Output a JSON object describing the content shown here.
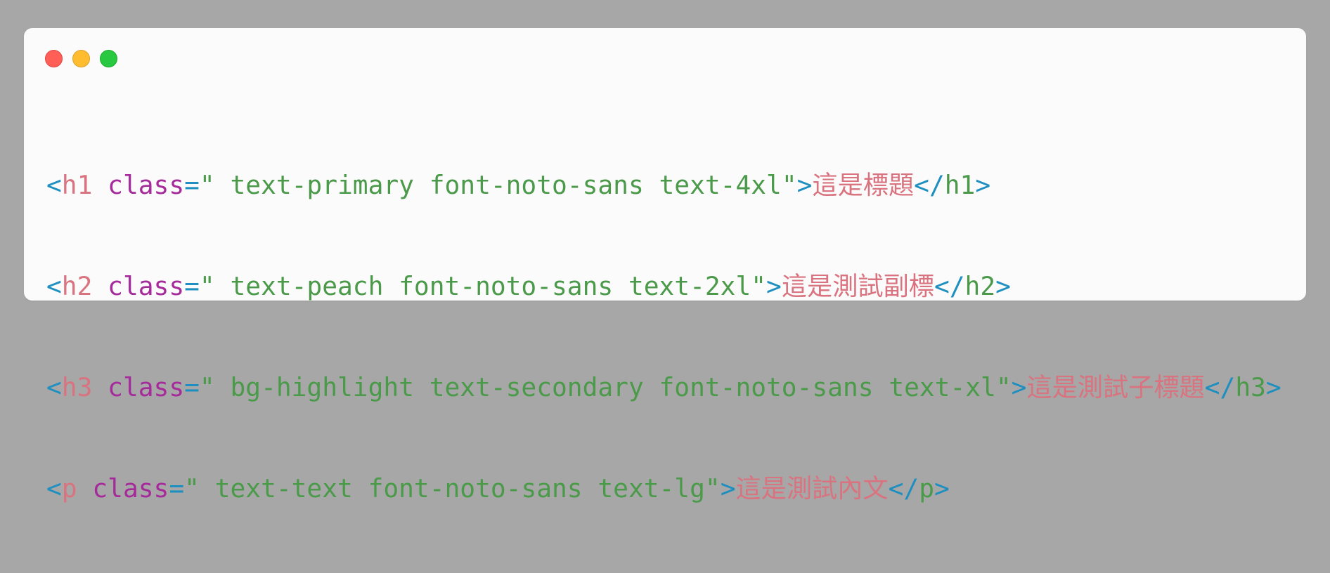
{
  "window": {
    "controls": [
      {
        "name": "close",
        "color": "#ff5f57"
      },
      {
        "name": "minimize",
        "color": "#febc2e"
      },
      {
        "name": "maximize",
        "color": "#28c840"
      }
    ]
  },
  "code": {
    "lines": [
      {
        "tag": "h1",
        "attr": "class",
        "value": " text-primary font-noto-sans text-4xl",
        "content": "這是標題"
      },
      {
        "tag": "h2",
        "attr": "class",
        "value": " text-peach font-noto-sans text-2xl",
        "content": "這是測試副標"
      },
      {
        "tag": "h3",
        "attr": "class",
        "value": " bg-highlight text-secondary font-noto-sans text-xl",
        "content": "這是測試子標題"
      },
      {
        "tag": "p",
        "attr": "class",
        "value": " text-text font-noto-sans text-lg",
        "content": "這是測試內文"
      }
    ],
    "colors": {
      "punctuation": "#1f8fbf",
      "tag": "#d9737f",
      "attribute": "#a52a9a",
      "string": "#4a9a4a",
      "content": "#d9737f"
    }
  }
}
